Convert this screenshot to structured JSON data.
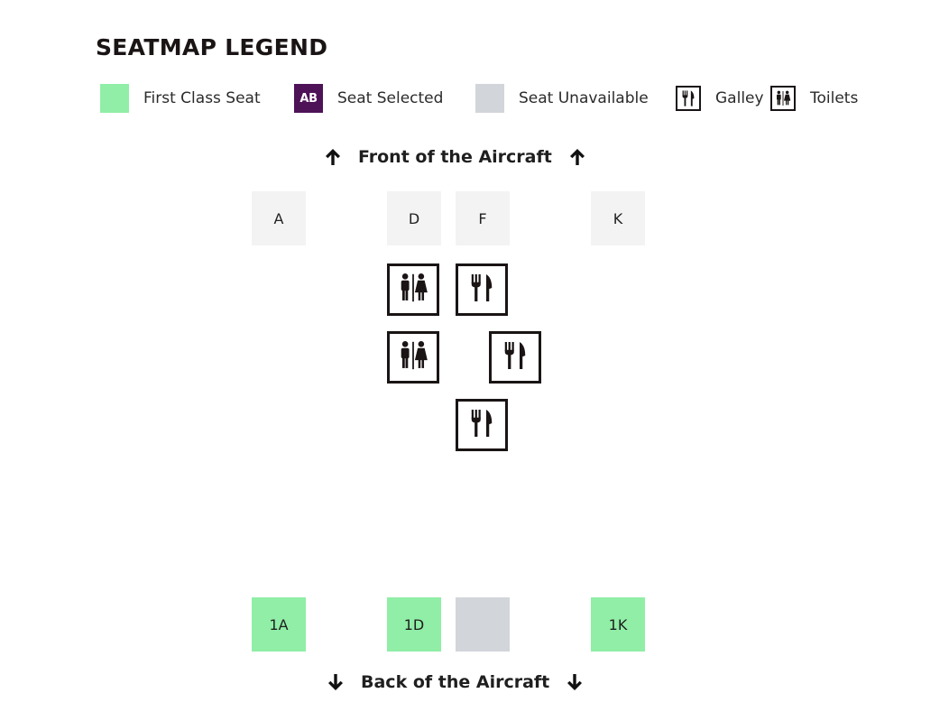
{
  "legend": {
    "title": "SEATMAP LEGEND",
    "items": [
      {
        "label": "First Class Seat",
        "swatch": "#90eea6"
      },
      {
        "label": "Seat Selected",
        "swatch": "#4e1257",
        "swatch_text": "AB"
      },
      {
        "label": "Seat Unavailable",
        "swatch": "#d2d5da"
      },
      {
        "label": "Galley",
        "icon": "galley-icon"
      },
      {
        "label": "Toilets",
        "icon": "toilets-icon"
      }
    ]
  },
  "cabin": {
    "front_label": "Front of the Aircraft",
    "back_label": "Back of the Aircraft",
    "columns": [
      "A",
      "D",
      "F",
      "K"
    ],
    "facilities": [
      {
        "type": "toilets",
        "icon": "toilets-icon"
      },
      {
        "type": "galley",
        "icon": "galley-icon"
      },
      {
        "type": "toilets",
        "icon": "toilets-icon"
      },
      {
        "type": "galley",
        "icon": "galley-icon"
      },
      {
        "type": "galley",
        "icon": "galley-icon"
      }
    ],
    "row_1": [
      {
        "label": "1A",
        "status": "available",
        "color": "#90eea6"
      },
      {
        "label": "1D",
        "status": "available",
        "color": "#90eea6"
      },
      {
        "label": "",
        "status": "unavailable",
        "color": "#d2d5da"
      },
      {
        "label": "1K",
        "status": "available",
        "color": "#90eea6"
      }
    ]
  }
}
